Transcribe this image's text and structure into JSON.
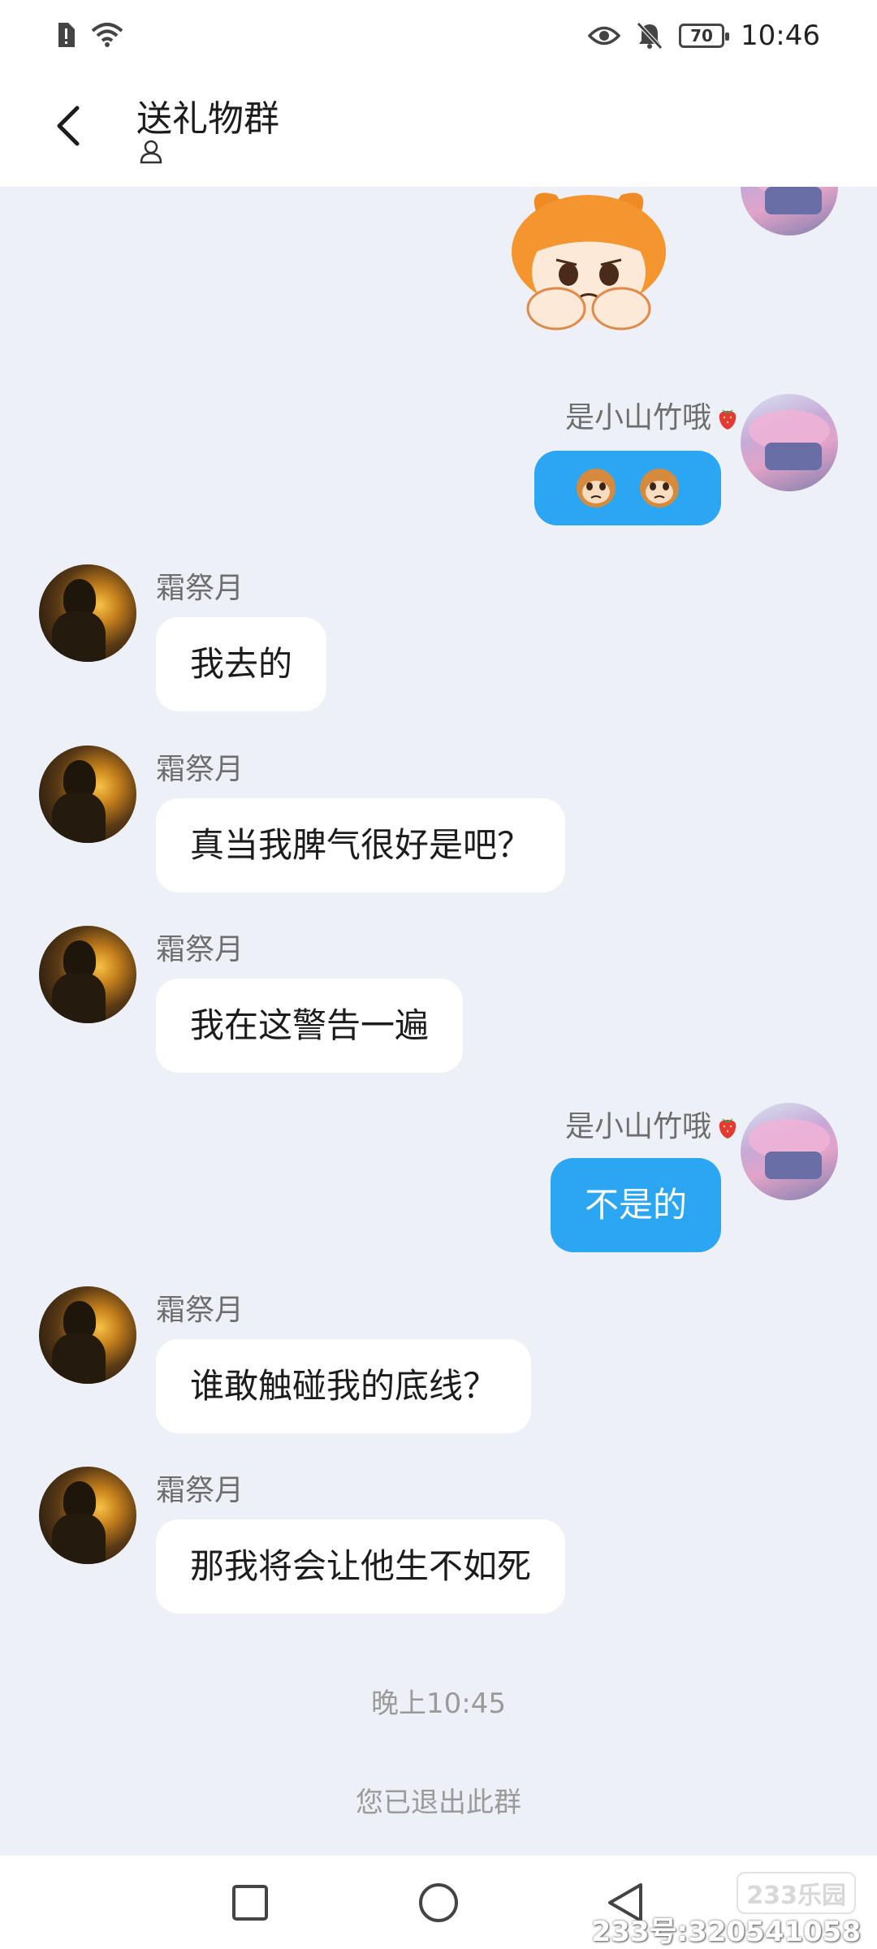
{
  "status_bar": {
    "time": "10:46",
    "battery": "70",
    "icons": [
      "sim-alert-icon",
      "wifi-icon",
      "eye-icon",
      "bell-off-icon",
      "battery-icon"
    ]
  },
  "header": {
    "title": "送礼物群",
    "back_icon": "chevron-left-icon",
    "member_icon": "person-icon"
  },
  "colors": {
    "outgoing_bubble": "#2ba6f2",
    "incoming_bubble": "#ffffff",
    "chat_background": "#eef0f7"
  },
  "messages": [
    {
      "side": "right",
      "type": "sticker",
      "sticker": "sad-orange-hair-girl-sticker"
    },
    {
      "side": "right",
      "sender": "是小山竹哦",
      "type": "emoji",
      "emojis": [
        "monkey-emoji",
        "monkey-emoji"
      ],
      "badge": "strawberry-emoji"
    },
    {
      "side": "left",
      "sender": "霜祭月",
      "text": "我去的"
    },
    {
      "side": "left",
      "sender": "霜祭月",
      "text": "真当我脾气很好是吧？"
    },
    {
      "side": "left",
      "sender": "霜祭月",
      "text": "我在这警告一遍"
    },
    {
      "side": "right",
      "sender": "是小山竹哦",
      "text": "不是的",
      "badge": "strawberry-emoji"
    },
    {
      "side": "left",
      "sender": "霜祭月",
      "text": "谁敢触碰我的底线？"
    },
    {
      "side": "left",
      "sender": "霜祭月",
      "text": "那我将会让他生不如死"
    }
  ],
  "timestamp": "晚上10:45",
  "system_message": "您已退出此群",
  "nav": {
    "recents_icon": "square-icon",
    "home_icon": "circle-icon",
    "back_icon": "triangle-back-icon"
  },
  "watermark": {
    "logo": "233乐园",
    "id": "233号:320541058"
  }
}
